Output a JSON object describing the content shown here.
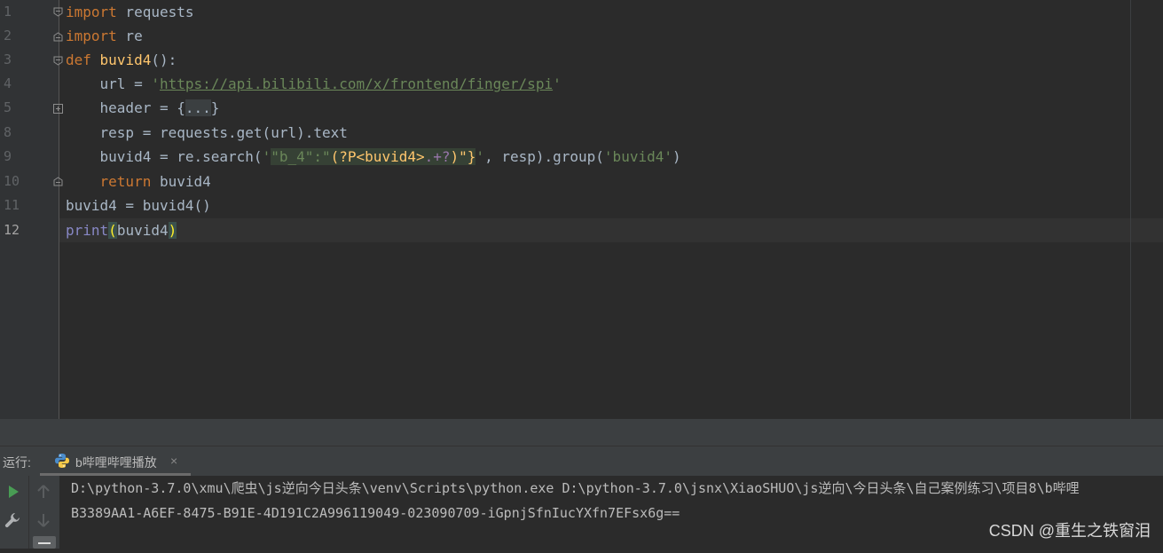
{
  "editor": {
    "line_numbers": [
      "1",
      "2",
      "3",
      "4",
      "5",
      "8",
      "9",
      "10",
      "11",
      "12"
    ],
    "current_line_number": "12",
    "lines": {
      "l1": {
        "kw": "import",
        "rest": " requests"
      },
      "l2": {
        "kw": "import",
        "rest": " re"
      },
      "l3": {
        "kw": "def",
        "fname": "buvid4",
        "rest": "():"
      },
      "l4": {
        "pre": "    url = ",
        "q1": "'",
        "url": "https://api.bilibili.com/x/frontend/finger/spi",
        "q2": "'"
      },
      "l5": {
        "pre": "    header = {",
        "folded": "...",
        "post": "}"
      },
      "l8": {
        "pre": "    resp = requests.get(url).text"
      },
      "l9": {
        "pre": "    buvid4 = re.search(",
        "q": "'",
        "rx1": "\"b_4\":\"",
        "rx2": "(?P<buvid4>",
        "rx3": ".+?",
        "rx4": ")\"}",
        "q2": "'",
        "mid": ", resp).group(",
        "arg": "'buvid4'",
        "end": ")"
      },
      "l10": {
        "kw": "    return",
        "rest": " buvid4"
      },
      "l11": {
        "pre": "buvid4 = buvid4()"
      },
      "l12": {
        "fn": "print",
        "open": "(",
        "arg": "buvid4",
        "close": ")"
      }
    }
  },
  "run_panel": {
    "label": "运行:",
    "tab_name": "b哔哩哔哩播放",
    "tab_close": "×",
    "console_lines": [
      "D:\\python-3.7.0\\xmu\\爬虫\\js逆向今日头条\\venv\\Scripts\\python.exe D:\\python-3.7.0\\jsnx\\XiaoSHUO\\js逆向\\今日头条\\自己案例练习\\项目8\\b哔哩",
      "B3389AA1-A6EF-8475-B91E-4D191C2A996119049-023090709-iGpnjSfnIucYXfn7EFsx6g=="
    ]
  },
  "icons": {
    "run": "run-icon",
    "wrench": "wrench-icon",
    "up": "arrow-up-icon",
    "down": "arrow-down-icon",
    "python": "python-icon"
  },
  "watermark": "CSDN @重生之铁窗泪"
}
